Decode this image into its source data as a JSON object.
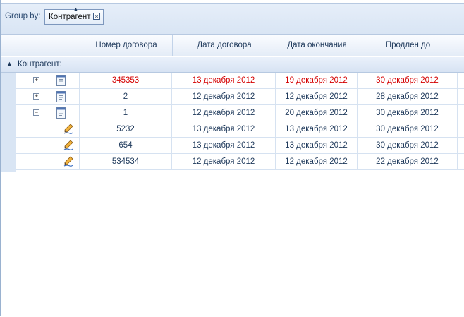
{
  "groupby": {
    "label": "Group by:",
    "chip_label": "Контрагент",
    "close_glyph": "×"
  },
  "columns": [
    "Номер договора",
    "Дата договора",
    "Дата окончания",
    "Продлен до"
  ],
  "group": {
    "label": "Контрагент:",
    "toggle_glyph": "▲"
  },
  "rows": [
    {
      "expander": "+",
      "icon": "document-icon",
      "number": "345353",
      "date": "13 декабря 2012",
      "end": "19 декабря 2012",
      "extended": "30 декабря 2012",
      "highlight": true
    },
    {
      "expander": "+",
      "icon": "document-icon",
      "number": "2",
      "date": "12 декабря 2012",
      "end": "12 декабря 2012",
      "extended": "28 декабря 2012",
      "highlight": false
    },
    {
      "expander": "−",
      "icon": "document-icon",
      "number": "1",
      "date": "12 декабря 2012",
      "end": "20 декабря 2012",
      "extended": "30 декабря 2012",
      "highlight": false
    },
    {
      "expander": "",
      "icon": "pencil-icon",
      "number": "5232",
      "date": "13 декабря 2012",
      "end": "13 декабря 2012",
      "extended": "30 декабря 2012",
      "highlight": false
    },
    {
      "expander": "",
      "icon": "pencil-icon",
      "number": "654",
      "date": "13 декабря 2012",
      "end": "13 декабря 2012",
      "extended": "30 декабря 2012",
      "highlight": false
    },
    {
      "expander": "",
      "icon": "pencil-icon",
      "number": "534534",
      "date": "12 декабря 2012",
      "end": "12 декабря 2012",
      "extended": "22 декабря 2012",
      "highlight": false
    }
  ],
  "colors": {
    "highlight_text": "#d40000",
    "text": "#1e395b",
    "header_bg": "#e4ecf7"
  }
}
